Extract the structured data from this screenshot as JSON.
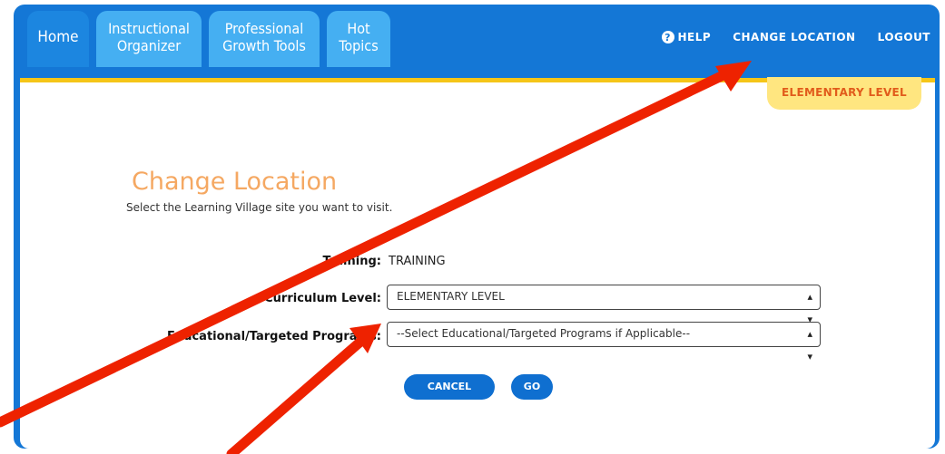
{
  "tabs": [
    {
      "line1": "Home",
      "line2": ""
    },
    {
      "line1": "Instructional",
      "line2": "Organizer"
    },
    {
      "line1": "Professional",
      "line2": "Growth Tools"
    },
    {
      "line1": "Hot",
      "line2": "Topics"
    }
  ],
  "topnav": {
    "help": "HELP",
    "change_location": "CHANGE LOCATION",
    "logout": "LOGOUT"
  },
  "level_badge": "ELEMENTARY LEVEL",
  "page": {
    "title": "Change Location",
    "subtitle": "Select the Learning Village site you want to visit."
  },
  "form": {
    "training_label": "Training:",
    "training_value": "TRAINING",
    "curriculum_label": "Curriculum Level:",
    "curriculum_value": "ELEMENTARY LEVEL",
    "programs_label": "Educational/Targeted Programs:",
    "programs_placeholder": "--Select Educational/Targeted Programs if Applicable--"
  },
  "buttons": {
    "cancel": "CANCEL",
    "go": "GO"
  },
  "colors": {
    "header_blue": "#1477d6",
    "tab_light_blue": "#45aff2",
    "accent_yellow": "#f5c518",
    "badge_orange": "#e15b1b",
    "title_orange": "#f5a862",
    "annotation_red": "#ee2200"
  }
}
